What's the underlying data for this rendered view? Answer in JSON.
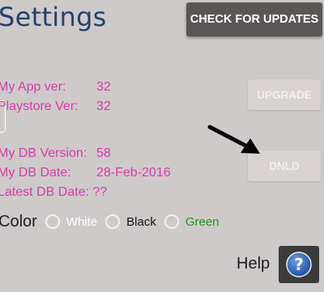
{
  "header": {
    "title": "Settings",
    "check_updates_label": "CHECK FOR UPDATES"
  },
  "app": {
    "my_app_ver_label": "My App ver:",
    "my_app_ver_value": "32",
    "playstore_ver_label": "Playstore Ver:",
    "playstore_ver_value": "32",
    "upgrade_label": "UPGRADE"
  },
  "db": {
    "version_label": "My DB Version:",
    "version_value": "58",
    "date_label": "My DB Date:",
    "date_value": "28-Feb-2016",
    "latest_label": "Latest DB Date:",
    "latest_value": "??",
    "download_label": "DNLD"
  },
  "color": {
    "label": "Color",
    "options": [
      {
        "label": "White",
        "color": "#ffffff"
      },
      {
        "label": "Black",
        "color": "#111111"
      },
      {
        "label": "Green",
        "color": "#1a9a1a"
      }
    ]
  },
  "help": {
    "label": "Help"
  },
  "colors": {
    "accent_text": "#d83aa8",
    "title": "#23416a",
    "help_icon": "#2f5fb0"
  }
}
